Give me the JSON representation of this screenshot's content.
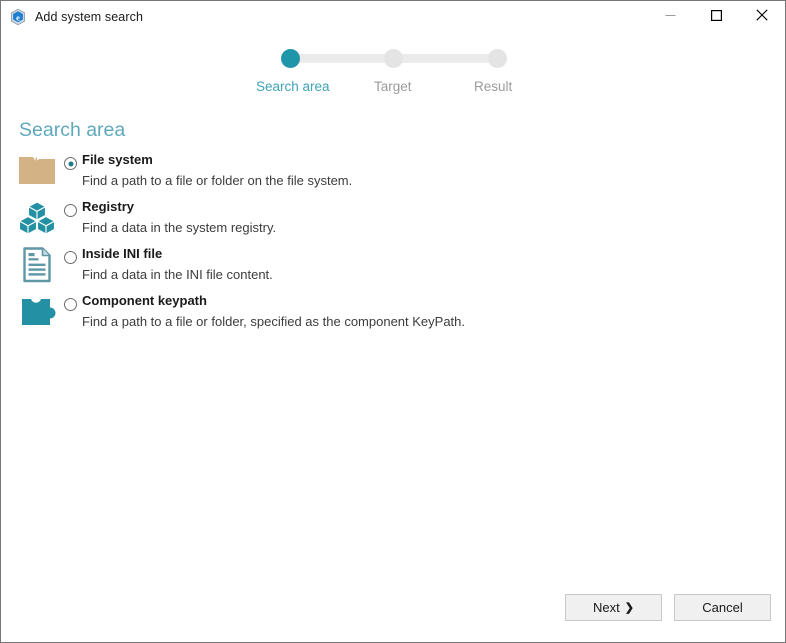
{
  "window": {
    "title": "Add system search",
    "icon": "hexagon-badge-icon",
    "controls": {
      "minimize_label": "—",
      "maximize_label": "☐",
      "close_label": "✕",
      "minimize_name": "minimize",
      "maximize_name": "maximize",
      "close_name": "close"
    }
  },
  "stepper": {
    "steps": [
      {
        "label": "Search area",
        "state": "active"
      },
      {
        "label": "Target",
        "state": "inactive"
      },
      {
        "label": "Result",
        "state": "inactive"
      }
    ],
    "active_color": "#1e95a8",
    "inactive_color": "#e4e4e4",
    "track_color": "#ebebeb",
    "active_text_color": "#3fa4b5",
    "inactive_text_color": "#9b9b9b"
  },
  "page": {
    "title": "Search area",
    "title_color": "#5fa8bc"
  },
  "options": [
    {
      "icon": "folder-icon",
      "icon_color": "#d3b286",
      "label": "File system",
      "description": "Find a path to a file or folder on the file system.",
      "selected": true
    },
    {
      "icon": "registry-cubes-icon",
      "icon_color": "#2391a3",
      "label": "Registry",
      "description": "Find a data in the system registry.",
      "selected": false
    },
    {
      "icon": "ini-document-icon",
      "icon_color": "#5e97a5",
      "label": "Inside INI file",
      "description": "Find a data in the INI file content.",
      "selected": false
    },
    {
      "icon": "puzzle-piece-icon",
      "icon_color": "#2391a3",
      "label": "Component keypath",
      "description": "Find a path to a file or folder, specified as the component KeyPath.",
      "selected": false
    }
  ],
  "footer": {
    "next_label": "Next",
    "next_chevron": "❯",
    "cancel_label": "Cancel"
  }
}
